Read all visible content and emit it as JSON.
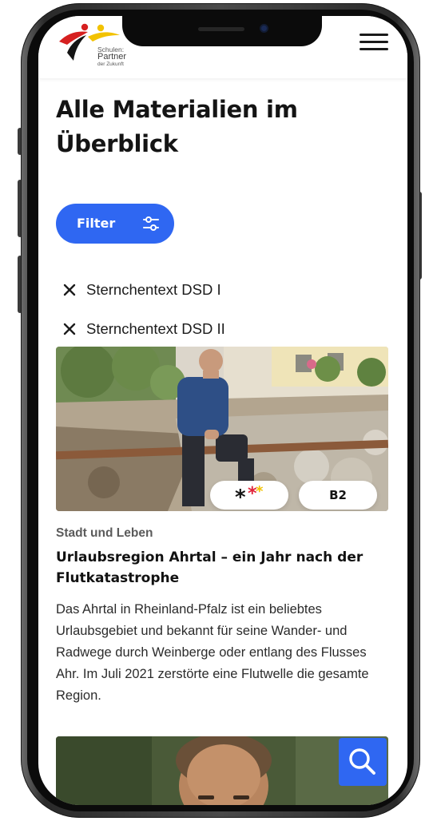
{
  "header": {
    "logo": {
      "line1": "Schulen:",
      "line2": "Partner",
      "line3": "der Zukunft",
      "colors": [
        "#d62020",
        "#f2c200",
        "#141414"
      ]
    },
    "menu_icon": "hamburger-menu-icon"
  },
  "page": {
    "title_line1": "Alle Materialien im",
    "title_line2": "Überblick"
  },
  "filter": {
    "label": "Filter",
    "icon": "sliders-icon",
    "accent": "#2f67f2",
    "active": [
      {
        "label": "Sternchentext DSD I",
        "icon": "close-icon"
      },
      {
        "label": "Sternchentext DSD II",
        "icon": "close-icon"
      }
    ]
  },
  "cards": [
    {
      "image": "man-sitting-on-construction-site-photo",
      "badge_icon": "stars-icon",
      "level": "B2",
      "category": "Stadt und Leben",
      "title": "Urlaubsregion Ahrtal – ein Jahr nach der Flutkatastrophe",
      "text": "Das Ahrtal in Rheinland-Pfalz ist ein beliebtes Urlaubsgebiet und bekannt für seine Wander- und Radwege durch Weinberge oder entlang des Flusses Ahr. Im Juli 2021 zerstörte eine Flutwelle die gesamte Region."
    },
    {
      "image": "man-portrait-photo"
    }
  ],
  "search_button": {
    "icon": "search-icon"
  }
}
